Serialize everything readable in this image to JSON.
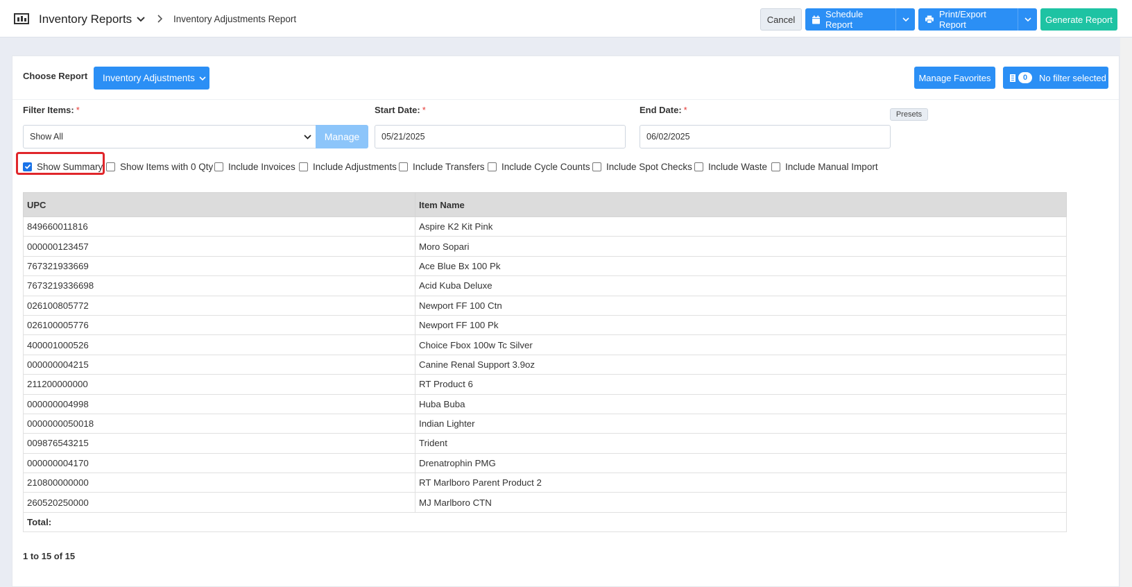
{
  "header": {
    "title": "Inventory Reports",
    "breadcrumb": "Inventory Adjustments Report",
    "cancel_label": "Cancel",
    "schedule_label": "Schedule Report",
    "print_label": "Print/Export Report",
    "generate_label": "Generate Report"
  },
  "toolbar": {
    "choose_label": "Choose Report",
    "report_selected": "Inventory Adjustments",
    "favorites_label": "Manage Favorites",
    "filter_count": "0",
    "filter_label": "No filter selected"
  },
  "filters": {
    "filter_items_label": "Filter Items:",
    "filter_items_value": "Show All",
    "manage_label": "Manage",
    "start_label": "Start Date:",
    "start_value": "05/21/2025",
    "end_label": "End Date:",
    "end_value": "06/02/2025",
    "presets_label": "Presets",
    "required_mark": "*"
  },
  "options": [
    {
      "label": "Show Summary",
      "checked": true
    },
    {
      "label": "Show Items with 0 Qty",
      "checked": false
    },
    {
      "label": "Include Invoices",
      "checked": false
    },
    {
      "label": "Include Adjustments",
      "checked": false
    },
    {
      "label": "Include Transfers",
      "checked": false
    },
    {
      "label": "Include Cycle Counts",
      "checked": false
    },
    {
      "label": "Include Spot Checks",
      "checked": false
    },
    {
      "label": "Include Waste",
      "checked": false
    },
    {
      "label": "Include Manual Import",
      "checked": false
    }
  ],
  "table": {
    "columns": [
      "UPC",
      "Item Name"
    ],
    "rows": [
      [
        "849660011816",
        "Aspire K2 Kit Pink"
      ],
      [
        "000000123457",
        "Moro Sopari"
      ],
      [
        "767321933669",
        "Ace Blue Bx 100 Pk"
      ],
      [
        "7673219336698",
        "Acid Kuba Deluxe"
      ],
      [
        "026100805772",
        "Newport FF 100 Ctn"
      ],
      [
        "026100005776",
        "Newport FF 100 Pk"
      ],
      [
        "400001000526",
        "Choice Fbox 100w Tc Silver"
      ],
      [
        "000000004215",
        "Canine Renal Support 3.9oz"
      ],
      [
        "211200000000",
        "RT Product 6"
      ],
      [
        "000000004998",
        "Huba Buba"
      ],
      [
        "0000000050018",
        "Indian Lighter"
      ],
      [
        "009876543215",
        "Trident"
      ],
      [
        "000000004170",
        "Drenatrophin PMG"
      ],
      [
        "210800000000",
        "RT Marlboro Parent Product 2"
      ],
      [
        "260520250000",
        "MJ Marlboro CTN"
      ]
    ],
    "total_label": "Total:"
  },
  "pager_text": "1 to 15 of 15",
  "colors": {
    "primary": "#2b8ff5",
    "success": "#1ec3a3",
    "highlight": "#e0262b"
  }
}
